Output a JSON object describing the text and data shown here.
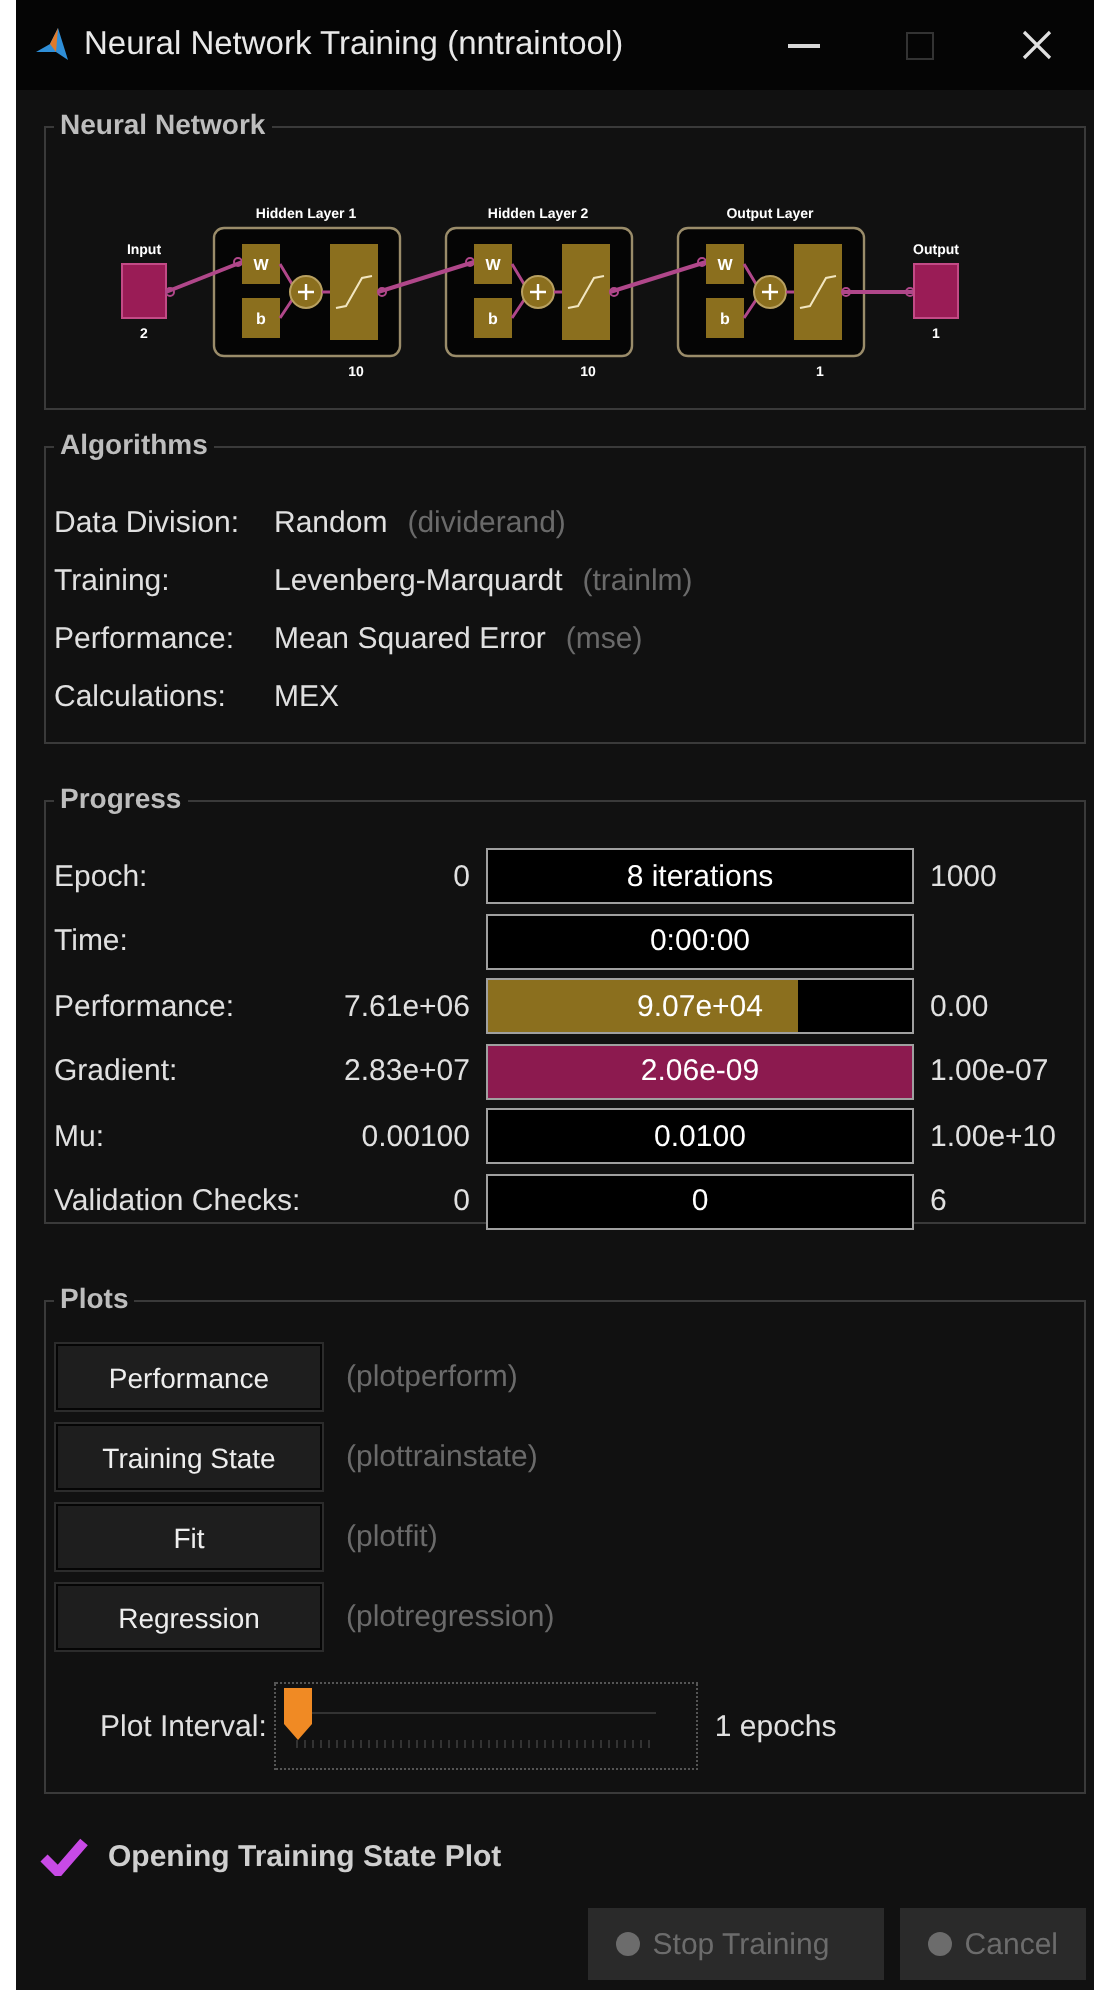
{
  "window": {
    "title": "Neural Network Training (nntraintool)",
    "maximize_disabled": true
  },
  "network": {
    "title": "Neural Network",
    "input": {
      "label": "Input",
      "size": "2"
    },
    "layers": [
      {
        "title": "Hidden Layer 1",
        "size": "10",
        "weight": "W",
        "bias": "b"
      },
      {
        "title": "Hidden Layer 2",
        "size": "10",
        "weight": "W",
        "bias": "b"
      },
      {
        "title": "Output Layer",
        "size": "1",
        "weight": "W",
        "bias": "b"
      }
    ],
    "output": {
      "label": "Output",
      "size": "1"
    }
  },
  "algorithms": {
    "title": "Algorithms",
    "rows": [
      {
        "label": "Data Division:",
        "value": "Random",
        "function": "(dividerand)"
      },
      {
        "label": "Training:",
        "value": "Levenberg-Marquardt",
        "function": "(trainlm)"
      },
      {
        "label": "Performance:",
        "value": "Mean Squared Error",
        "function": "(mse)"
      },
      {
        "label": "Calculations:",
        "value": "MEX"
      }
    ]
  },
  "progress": {
    "title": "Progress",
    "rows": [
      {
        "label": "Epoch:",
        "min": "0",
        "value": "8 iterations",
        "max": "1000"
      },
      {
        "label": "Time:",
        "value": "0:00:00"
      },
      {
        "label": "Performance:",
        "min": "7.61e+06",
        "value": "9.07e+04",
        "max": "0.00",
        "level": 0.73,
        "color": "#8b6f1e"
      },
      {
        "label": "Gradient:",
        "min": "2.83e+07",
        "value": "2.06e-09",
        "max": "1.00e-07",
        "level": 1,
        "color": "#8c1a4f"
      },
      {
        "label": "Mu:",
        "min": "0.00100",
        "value": "0.0100",
        "max": "1.00e+10"
      },
      {
        "label": "Validation Checks:",
        "min": "0",
        "value": "0",
        "max": "6"
      }
    ]
  },
  "plots": {
    "title": "Plots",
    "buttons": [
      {
        "label": "Performance",
        "function": "(plotperform)"
      },
      {
        "label": "Training State",
        "function": "(plottrainstate)"
      },
      {
        "label": "Fit",
        "function": "(plotfit)"
      },
      {
        "label": "Regression",
        "function": "(plotregression)"
      }
    ],
    "interval": {
      "label": "Plot Interval:",
      "level": 0,
      "reading": "1 epochs"
    }
  },
  "status": {
    "checked": true,
    "text": "Opening Training State Plot"
  },
  "buttons": [
    {
      "label": "Stop Training",
      "disabled": true
    },
    {
      "label": "Cancel",
      "disabled": true
    }
  ]
}
